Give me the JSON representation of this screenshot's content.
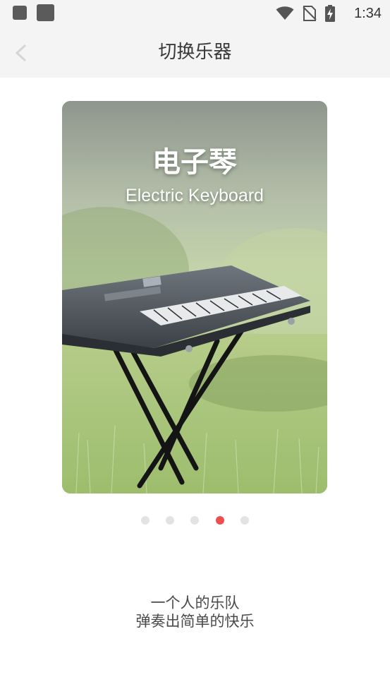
{
  "status_bar": {
    "time": "1:34",
    "icons": [
      "app-notification-icon",
      "app-notification-icon",
      "wifi-icon",
      "no-sim-icon",
      "battery-charging-icon"
    ]
  },
  "header": {
    "title": "切换乐器"
  },
  "carousel": {
    "title_cn": "电子琴",
    "title_en": "Electric Keyboard",
    "page_count": 5,
    "active_index": 3,
    "active_color": "#ee4e4e",
    "inactive_color": "#e3e3e3"
  },
  "caption": {
    "line1": "一个人的乐队",
    "line2": "弹奏出简单的快乐"
  }
}
